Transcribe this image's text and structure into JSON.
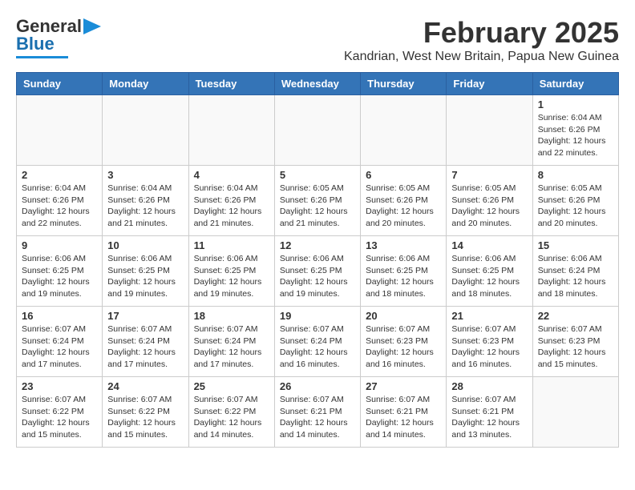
{
  "header": {
    "logo_line1": "General",
    "logo_line2": "Blue",
    "main_title": "February 2025",
    "subtitle": "Kandrian, West New Britain, Papua New Guinea"
  },
  "calendar": {
    "weekdays": [
      "Sunday",
      "Monday",
      "Tuesday",
      "Wednesday",
      "Thursday",
      "Friday",
      "Saturday"
    ],
    "weeks": [
      [
        {
          "day": "",
          "info": ""
        },
        {
          "day": "",
          "info": ""
        },
        {
          "day": "",
          "info": ""
        },
        {
          "day": "",
          "info": ""
        },
        {
          "day": "",
          "info": ""
        },
        {
          "day": "",
          "info": ""
        },
        {
          "day": "1",
          "info": "Sunrise: 6:04 AM\nSunset: 6:26 PM\nDaylight: 12 hours\nand 22 minutes."
        }
      ],
      [
        {
          "day": "2",
          "info": "Sunrise: 6:04 AM\nSunset: 6:26 PM\nDaylight: 12 hours\nand 22 minutes."
        },
        {
          "day": "3",
          "info": "Sunrise: 6:04 AM\nSunset: 6:26 PM\nDaylight: 12 hours\nand 21 minutes."
        },
        {
          "day": "4",
          "info": "Sunrise: 6:04 AM\nSunset: 6:26 PM\nDaylight: 12 hours\nand 21 minutes."
        },
        {
          "day": "5",
          "info": "Sunrise: 6:05 AM\nSunset: 6:26 PM\nDaylight: 12 hours\nand 21 minutes."
        },
        {
          "day": "6",
          "info": "Sunrise: 6:05 AM\nSunset: 6:26 PM\nDaylight: 12 hours\nand 20 minutes."
        },
        {
          "day": "7",
          "info": "Sunrise: 6:05 AM\nSunset: 6:26 PM\nDaylight: 12 hours\nand 20 minutes."
        },
        {
          "day": "8",
          "info": "Sunrise: 6:05 AM\nSunset: 6:26 PM\nDaylight: 12 hours\nand 20 minutes."
        }
      ],
      [
        {
          "day": "9",
          "info": "Sunrise: 6:06 AM\nSunset: 6:25 PM\nDaylight: 12 hours\nand 19 minutes."
        },
        {
          "day": "10",
          "info": "Sunrise: 6:06 AM\nSunset: 6:25 PM\nDaylight: 12 hours\nand 19 minutes."
        },
        {
          "day": "11",
          "info": "Sunrise: 6:06 AM\nSunset: 6:25 PM\nDaylight: 12 hours\nand 19 minutes."
        },
        {
          "day": "12",
          "info": "Sunrise: 6:06 AM\nSunset: 6:25 PM\nDaylight: 12 hours\nand 19 minutes."
        },
        {
          "day": "13",
          "info": "Sunrise: 6:06 AM\nSunset: 6:25 PM\nDaylight: 12 hours\nand 18 minutes."
        },
        {
          "day": "14",
          "info": "Sunrise: 6:06 AM\nSunset: 6:25 PM\nDaylight: 12 hours\nand 18 minutes."
        },
        {
          "day": "15",
          "info": "Sunrise: 6:06 AM\nSunset: 6:24 PM\nDaylight: 12 hours\nand 18 minutes."
        }
      ],
      [
        {
          "day": "16",
          "info": "Sunrise: 6:07 AM\nSunset: 6:24 PM\nDaylight: 12 hours\nand 17 minutes."
        },
        {
          "day": "17",
          "info": "Sunrise: 6:07 AM\nSunset: 6:24 PM\nDaylight: 12 hours\nand 17 minutes."
        },
        {
          "day": "18",
          "info": "Sunrise: 6:07 AM\nSunset: 6:24 PM\nDaylight: 12 hours\nand 17 minutes."
        },
        {
          "day": "19",
          "info": "Sunrise: 6:07 AM\nSunset: 6:24 PM\nDaylight: 12 hours\nand 16 minutes."
        },
        {
          "day": "20",
          "info": "Sunrise: 6:07 AM\nSunset: 6:23 PM\nDaylight: 12 hours\nand 16 minutes."
        },
        {
          "day": "21",
          "info": "Sunrise: 6:07 AM\nSunset: 6:23 PM\nDaylight: 12 hours\nand 16 minutes."
        },
        {
          "day": "22",
          "info": "Sunrise: 6:07 AM\nSunset: 6:23 PM\nDaylight: 12 hours\nand 15 minutes."
        }
      ],
      [
        {
          "day": "23",
          "info": "Sunrise: 6:07 AM\nSunset: 6:22 PM\nDaylight: 12 hours\nand 15 minutes."
        },
        {
          "day": "24",
          "info": "Sunrise: 6:07 AM\nSunset: 6:22 PM\nDaylight: 12 hours\nand 15 minutes."
        },
        {
          "day": "25",
          "info": "Sunrise: 6:07 AM\nSunset: 6:22 PM\nDaylight: 12 hours\nand 14 minutes."
        },
        {
          "day": "26",
          "info": "Sunrise: 6:07 AM\nSunset: 6:21 PM\nDaylight: 12 hours\nand 14 minutes."
        },
        {
          "day": "27",
          "info": "Sunrise: 6:07 AM\nSunset: 6:21 PM\nDaylight: 12 hours\nand 14 minutes."
        },
        {
          "day": "28",
          "info": "Sunrise: 6:07 AM\nSunset: 6:21 PM\nDaylight: 12 hours\nand 13 minutes."
        },
        {
          "day": "",
          "info": ""
        }
      ]
    ]
  }
}
